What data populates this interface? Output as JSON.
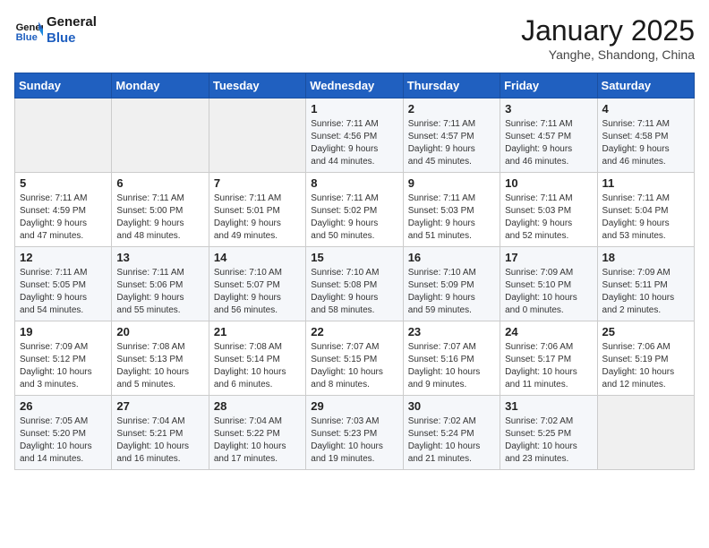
{
  "header": {
    "logo_line1": "General",
    "logo_line2": "Blue",
    "month": "January 2025",
    "location": "Yanghe, Shandong, China"
  },
  "days_of_week": [
    "Sunday",
    "Monday",
    "Tuesday",
    "Wednesday",
    "Thursday",
    "Friday",
    "Saturday"
  ],
  "weeks": [
    [
      {
        "day": "",
        "info": ""
      },
      {
        "day": "",
        "info": ""
      },
      {
        "day": "",
        "info": ""
      },
      {
        "day": "1",
        "info": "Sunrise: 7:11 AM\nSunset: 4:56 PM\nDaylight: 9 hours\nand 44 minutes."
      },
      {
        "day": "2",
        "info": "Sunrise: 7:11 AM\nSunset: 4:57 PM\nDaylight: 9 hours\nand 45 minutes."
      },
      {
        "day": "3",
        "info": "Sunrise: 7:11 AM\nSunset: 4:57 PM\nDaylight: 9 hours\nand 46 minutes."
      },
      {
        "day": "4",
        "info": "Sunrise: 7:11 AM\nSunset: 4:58 PM\nDaylight: 9 hours\nand 46 minutes."
      }
    ],
    [
      {
        "day": "5",
        "info": "Sunrise: 7:11 AM\nSunset: 4:59 PM\nDaylight: 9 hours\nand 47 minutes."
      },
      {
        "day": "6",
        "info": "Sunrise: 7:11 AM\nSunset: 5:00 PM\nDaylight: 9 hours\nand 48 minutes."
      },
      {
        "day": "7",
        "info": "Sunrise: 7:11 AM\nSunset: 5:01 PM\nDaylight: 9 hours\nand 49 minutes."
      },
      {
        "day": "8",
        "info": "Sunrise: 7:11 AM\nSunset: 5:02 PM\nDaylight: 9 hours\nand 50 minutes."
      },
      {
        "day": "9",
        "info": "Sunrise: 7:11 AM\nSunset: 5:03 PM\nDaylight: 9 hours\nand 51 minutes."
      },
      {
        "day": "10",
        "info": "Sunrise: 7:11 AM\nSunset: 5:03 PM\nDaylight: 9 hours\nand 52 minutes."
      },
      {
        "day": "11",
        "info": "Sunrise: 7:11 AM\nSunset: 5:04 PM\nDaylight: 9 hours\nand 53 minutes."
      }
    ],
    [
      {
        "day": "12",
        "info": "Sunrise: 7:11 AM\nSunset: 5:05 PM\nDaylight: 9 hours\nand 54 minutes."
      },
      {
        "day": "13",
        "info": "Sunrise: 7:11 AM\nSunset: 5:06 PM\nDaylight: 9 hours\nand 55 minutes."
      },
      {
        "day": "14",
        "info": "Sunrise: 7:10 AM\nSunset: 5:07 PM\nDaylight: 9 hours\nand 56 minutes."
      },
      {
        "day": "15",
        "info": "Sunrise: 7:10 AM\nSunset: 5:08 PM\nDaylight: 9 hours\nand 58 minutes."
      },
      {
        "day": "16",
        "info": "Sunrise: 7:10 AM\nSunset: 5:09 PM\nDaylight: 9 hours\nand 59 minutes."
      },
      {
        "day": "17",
        "info": "Sunrise: 7:09 AM\nSunset: 5:10 PM\nDaylight: 10 hours\nand 0 minutes."
      },
      {
        "day": "18",
        "info": "Sunrise: 7:09 AM\nSunset: 5:11 PM\nDaylight: 10 hours\nand 2 minutes."
      }
    ],
    [
      {
        "day": "19",
        "info": "Sunrise: 7:09 AM\nSunset: 5:12 PM\nDaylight: 10 hours\nand 3 minutes."
      },
      {
        "day": "20",
        "info": "Sunrise: 7:08 AM\nSunset: 5:13 PM\nDaylight: 10 hours\nand 5 minutes."
      },
      {
        "day": "21",
        "info": "Sunrise: 7:08 AM\nSunset: 5:14 PM\nDaylight: 10 hours\nand 6 minutes."
      },
      {
        "day": "22",
        "info": "Sunrise: 7:07 AM\nSunset: 5:15 PM\nDaylight: 10 hours\nand 8 minutes."
      },
      {
        "day": "23",
        "info": "Sunrise: 7:07 AM\nSunset: 5:16 PM\nDaylight: 10 hours\nand 9 minutes."
      },
      {
        "day": "24",
        "info": "Sunrise: 7:06 AM\nSunset: 5:17 PM\nDaylight: 10 hours\nand 11 minutes."
      },
      {
        "day": "25",
        "info": "Sunrise: 7:06 AM\nSunset: 5:19 PM\nDaylight: 10 hours\nand 12 minutes."
      }
    ],
    [
      {
        "day": "26",
        "info": "Sunrise: 7:05 AM\nSunset: 5:20 PM\nDaylight: 10 hours\nand 14 minutes."
      },
      {
        "day": "27",
        "info": "Sunrise: 7:04 AM\nSunset: 5:21 PM\nDaylight: 10 hours\nand 16 minutes."
      },
      {
        "day": "28",
        "info": "Sunrise: 7:04 AM\nSunset: 5:22 PM\nDaylight: 10 hours\nand 17 minutes."
      },
      {
        "day": "29",
        "info": "Sunrise: 7:03 AM\nSunset: 5:23 PM\nDaylight: 10 hours\nand 19 minutes."
      },
      {
        "day": "30",
        "info": "Sunrise: 7:02 AM\nSunset: 5:24 PM\nDaylight: 10 hours\nand 21 minutes."
      },
      {
        "day": "31",
        "info": "Sunrise: 7:02 AM\nSunset: 5:25 PM\nDaylight: 10 hours\nand 23 minutes."
      },
      {
        "day": "",
        "info": ""
      }
    ]
  ]
}
